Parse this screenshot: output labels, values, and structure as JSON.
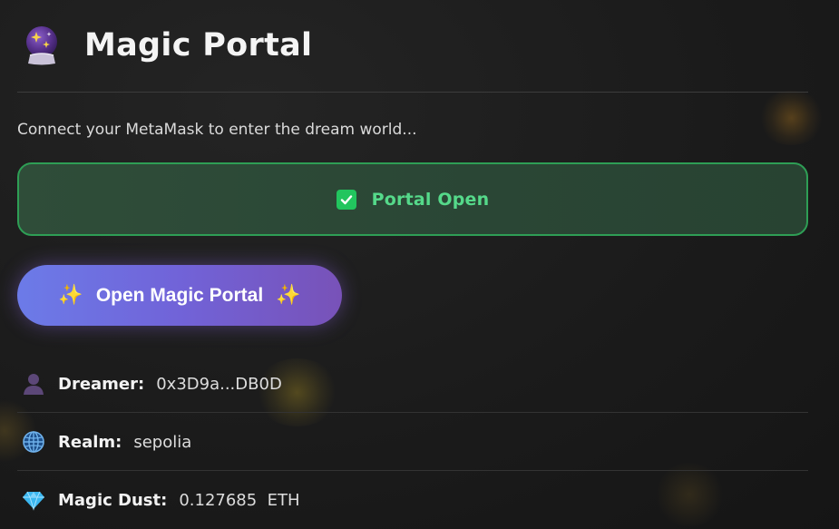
{
  "header": {
    "icon": "crystal-ball-icon",
    "title": "Magic Portal"
  },
  "subtitle": "Connect your MetaMask to enter the dream world...",
  "status": {
    "icon": "check-box-icon",
    "text": "Portal Open",
    "color": "#22c55e"
  },
  "action": {
    "label": "Open Magic Portal",
    "sparkle_left": "✨",
    "sparkle_right": "✨"
  },
  "info": [
    {
      "icon": "user-silhouette-icon",
      "label": "Dreamer:",
      "value": "0x3D9a...DB0D"
    },
    {
      "icon": "globe-icon",
      "label": "Realm:",
      "value": "sepolia"
    },
    {
      "icon": "gem-icon",
      "label": "Magic Dust:",
      "value": "0.127685  ETH"
    }
  ]
}
